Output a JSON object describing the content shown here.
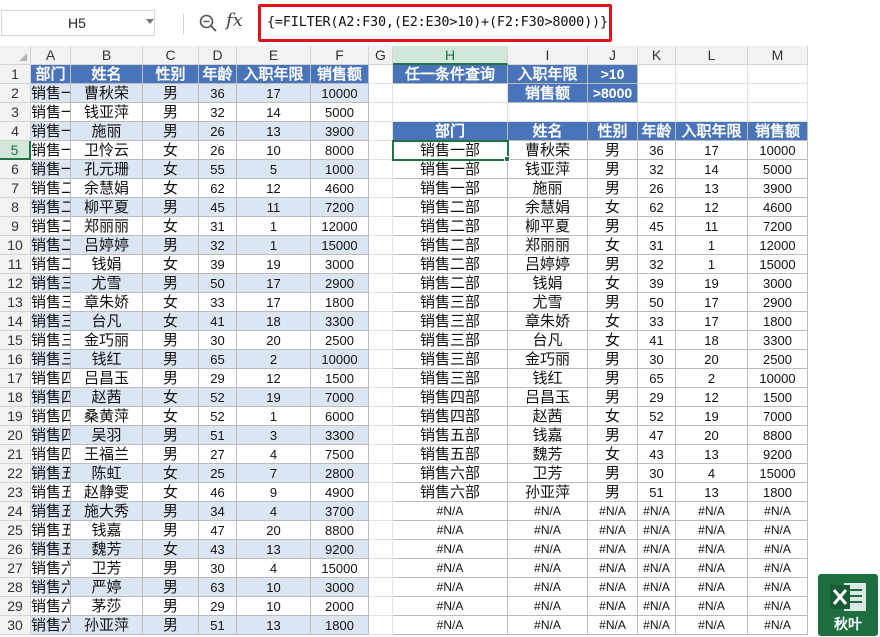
{
  "formula_bar": {
    "name_box": "H5",
    "fx_label": "fx",
    "formula": "{=FILTER(A2:F30,(E2:E30>10)+(F2:F30>8000))}"
  },
  "columns": [
    "A",
    "B",
    "C",
    "D",
    "E",
    "F",
    "G",
    "H",
    "I",
    "J",
    "K",
    "L",
    "M"
  ],
  "rows": [
    "1",
    "2",
    "3",
    "4",
    "5",
    "6",
    "7",
    "8",
    "9",
    "10",
    "11",
    "12",
    "13",
    "14",
    "15",
    "16",
    "17",
    "18",
    "19",
    "20",
    "21",
    "22",
    "23",
    "24",
    "25",
    "26",
    "27",
    "28",
    "29",
    "30"
  ],
  "source_table": {
    "headers": [
      "部门",
      "姓名",
      "性别",
      "年龄",
      "入职年限",
      "销售额"
    ],
    "rows": [
      [
        "销售一部",
        "曹秋荣",
        "男",
        "36",
        "17",
        "10000"
      ],
      [
        "销售一部",
        "钱亚萍",
        "男",
        "32",
        "14",
        "5000"
      ],
      [
        "销售一部",
        "施丽",
        "男",
        "26",
        "13",
        "3900"
      ],
      [
        "销售一部",
        "卫怜云",
        "女",
        "26",
        "10",
        "8000"
      ],
      [
        "销售一部",
        "孔元珊",
        "女",
        "55",
        "5",
        "1000"
      ],
      [
        "销售二部",
        "余慧娟",
        "女",
        "62",
        "12",
        "4600"
      ],
      [
        "销售二部",
        "柳平夏",
        "男",
        "45",
        "11",
        "7200"
      ],
      [
        "销售二部",
        "郑丽丽",
        "女",
        "31",
        "1",
        "12000"
      ],
      [
        "销售二部",
        "吕婷婷",
        "男",
        "32",
        "1",
        "15000"
      ],
      [
        "销售二部",
        "钱娟",
        "女",
        "39",
        "19",
        "3000"
      ],
      [
        "销售三部",
        "尤雪",
        "男",
        "50",
        "17",
        "2900"
      ],
      [
        "销售三部",
        "章朱娇",
        "女",
        "33",
        "17",
        "1800"
      ],
      [
        "销售三部",
        "台凡",
        "女",
        "41",
        "18",
        "3300"
      ],
      [
        "销售三部",
        "金巧丽",
        "男",
        "30",
        "20",
        "2500"
      ],
      [
        "销售三部",
        "钱红",
        "男",
        "65",
        "2",
        "10000"
      ],
      [
        "销售四部",
        "吕昌玉",
        "男",
        "29",
        "12",
        "1500"
      ],
      [
        "销售四部",
        "赵茜",
        "女",
        "52",
        "19",
        "7000"
      ],
      [
        "销售四部",
        "桑黄萍",
        "女",
        "52",
        "1",
        "6000"
      ],
      [
        "销售四部",
        "吴羽",
        "男",
        "51",
        "3",
        "3300"
      ],
      [
        "销售四部",
        "王福兰",
        "男",
        "27",
        "4",
        "7500"
      ],
      [
        "销售五部",
        "陈虹",
        "女",
        "25",
        "7",
        "2800"
      ],
      [
        "销售五部",
        "赵静雯",
        "女",
        "46",
        "9",
        "4900"
      ],
      [
        "销售五部",
        "施大秀",
        "男",
        "34",
        "4",
        "3700"
      ],
      [
        "销售五部",
        "钱嘉",
        "男",
        "47",
        "20",
        "8800"
      ],
      [
        "销售五部",
        "魏芳",
        "女",
        "43",
        "13",
        "9200"
      ],
      [
        "销售六部",
        "卫芳",
        "男",
        "30",
        "4",
        "15000"
      ],
      [
        "销售六部",
        "严婷",
        "男",
        "63",
        "10",
        "3000"
      ],
      [
        "销售六部",
        "茅莎",
        "男",
        "29",
        "10",
        "2000"
      ],
      [
        "销售六部",
        "孙亚萍",
        "男",
        "51",
        "13",
        "1800"
      ]
    ]
  },
  "criteria": {
    "title": "任一条件查询",
    "rows": [
      [
        "入职年限",
        ">10"
      ],
      [
        "销售额",
        ">8000"
      ]
    ]
  },
  "result_table": {
    "headers": [
      "部门",
      "姓名",
      "性别",
      "年龄",
      "入职年限",
      "销售额"
    ],
    "rows": [
      [
        "销售一部",
        "曹秋荣",
        "男",
        "36",
        "17",
        "10000"
      ],
      [
        "销售一部",
        "钱亚萍",
        "男",
        "32",
        "14",
        "5000"
      ],
      [
        "销售一部",
        "施丽",
        "男",
        "26",
        "13",
        "3900"
      ],
      [
        "销售二部",
        "余慧娟",
        "女",
        "62",
        "12",
        "4600"
      ],
      [
        "销售二部",
        "柳平夏",
        "男",
        "45",
        "11",
        "7200"
      ],
      [
        "销售二部",
        "郑丽丽",
        "女",
        "31",
        "1",
        "12000"
      ],
      [
        "销售二部",
        "吕婷婷",
        "男",
        "32",
        "1",
        "15000"
      ],
      [
        "销售二部",
        "钱娟",
        "女",
        "39",
        "19",
        "3000"
      ],
      [
        "销售三部",
        "尤雪",
        "男",
        "50",
        "17",
        "2900"
      ],
      [
        "销售三部",
        "章朱娇",
        "女",
        "33",
        "17",
        "1800"
      ],
      [
        "销售三部",
        "台凡",
        "女",
        "41",
        "18",
        "3300"
      ],
      [
        "销售三部",
        "金巧丽",
        "男",
        "30",
        "20",
        "2500"
      ],
      [
        "销售三部",
        "钱红",
        "男",
        "65",
        "2",
        "10000"
      ],
      [
        "销售四部",
        "吕昌玉",
        "男",
        "29",
        "12",
        "1500"
      ],
      [
        "销售四部",
        "赵茜",
        "女",
        "52",
        "19",
        "7000"
      ],
      [
        "销售五部",
        "钱嘉",
        "男",
        "47",
        "20",
        "8800"
      ],
      [
        "销售五部",
        "魏芳",
        "女",
        "43",
        "13",
        "9200"
      ],
      [
        "销售六部",
        "卫芳",
        "男",
        "30",
        "4",
        "15000"
      ],
      [
        "销售六部",
        "孙亚萍",
        "男",
        "51",
        "13",
        "1800"
      ]
    ],
    "error_value": "#N/A"
  },
  "watermark": {
    "text": "秋叶"
  },
  "colors": {
    "header_fill": "#4a74ba",
    "band_fill": "#dce6f2",
    "accent": "#217346",
    "highlight": "#e0141a"
  }
}
